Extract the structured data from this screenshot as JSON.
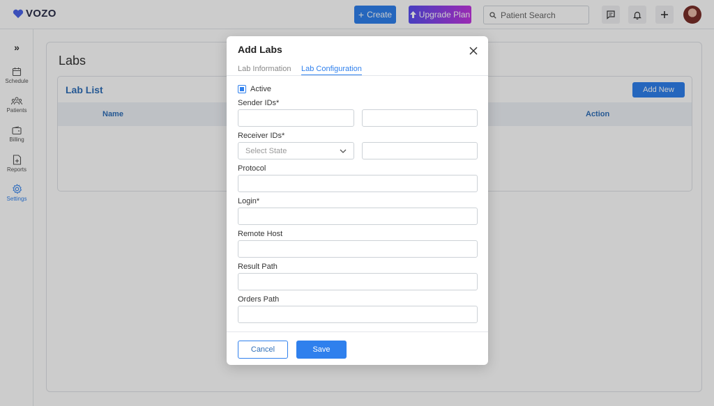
{
  "app": {
    "brand": "VOZO",
    "brand_color": "#4a63e8"
  },
  "topbar": {
    "create_label": "Create",
    "upgrade_label": "Upgrade Plan",
    "search_placeholder": "Patient Search"
  },
  "sidebar": {
    "items": [
      {
        "label": "Schedule",
        "icon": "calendar-icon"
      },
      {
        "label": "Patients",
        "icon": "patients-icon"
      },
      {
        "label": "Billing",
        "icon": "wallet-icon"
      },
      {
        "label": "Reports",
        "icon": "report-icon"
      },
      {
        "label": "Settings",
        "icon": "gear-icon"
      }
    ]
  },
  "page": {
    "title": "Labs",
    "list_title": "Lab List",
    "add_new_label": "Add New",
    "columns": [
      "Name",
      "Action"
    ]
  },
  "modal": {
    "title": "Add Labs",
    "tabs": [
      "Lab Information",
      "Lab Configuration"
    ],
    "active_tab": "Lab Configuration",
    "active_label": "Active",
    "active_checked": true,
    "fields": {
      "sender_ids": "Sender IDs*",
      "receiver_ids": "Receiver IDs*",
      "receiver_select_placeholder": "Select State",
      "protocol": "Protocol",
      "login": "Login*",
      "remote_host": "Remote Host",
      "result_path": "Result Path",
      "orders_path": "Orders Path"
    },
    "cancel_label": "Cancel",
    "save_label": "Save"
  },
  "colors": {
    "primary": "#2f80ed",
    "upgrade_gradient_start": "#5a4ff0",
    "upgrade_gradient_end": "#c135e0"
  }
}
